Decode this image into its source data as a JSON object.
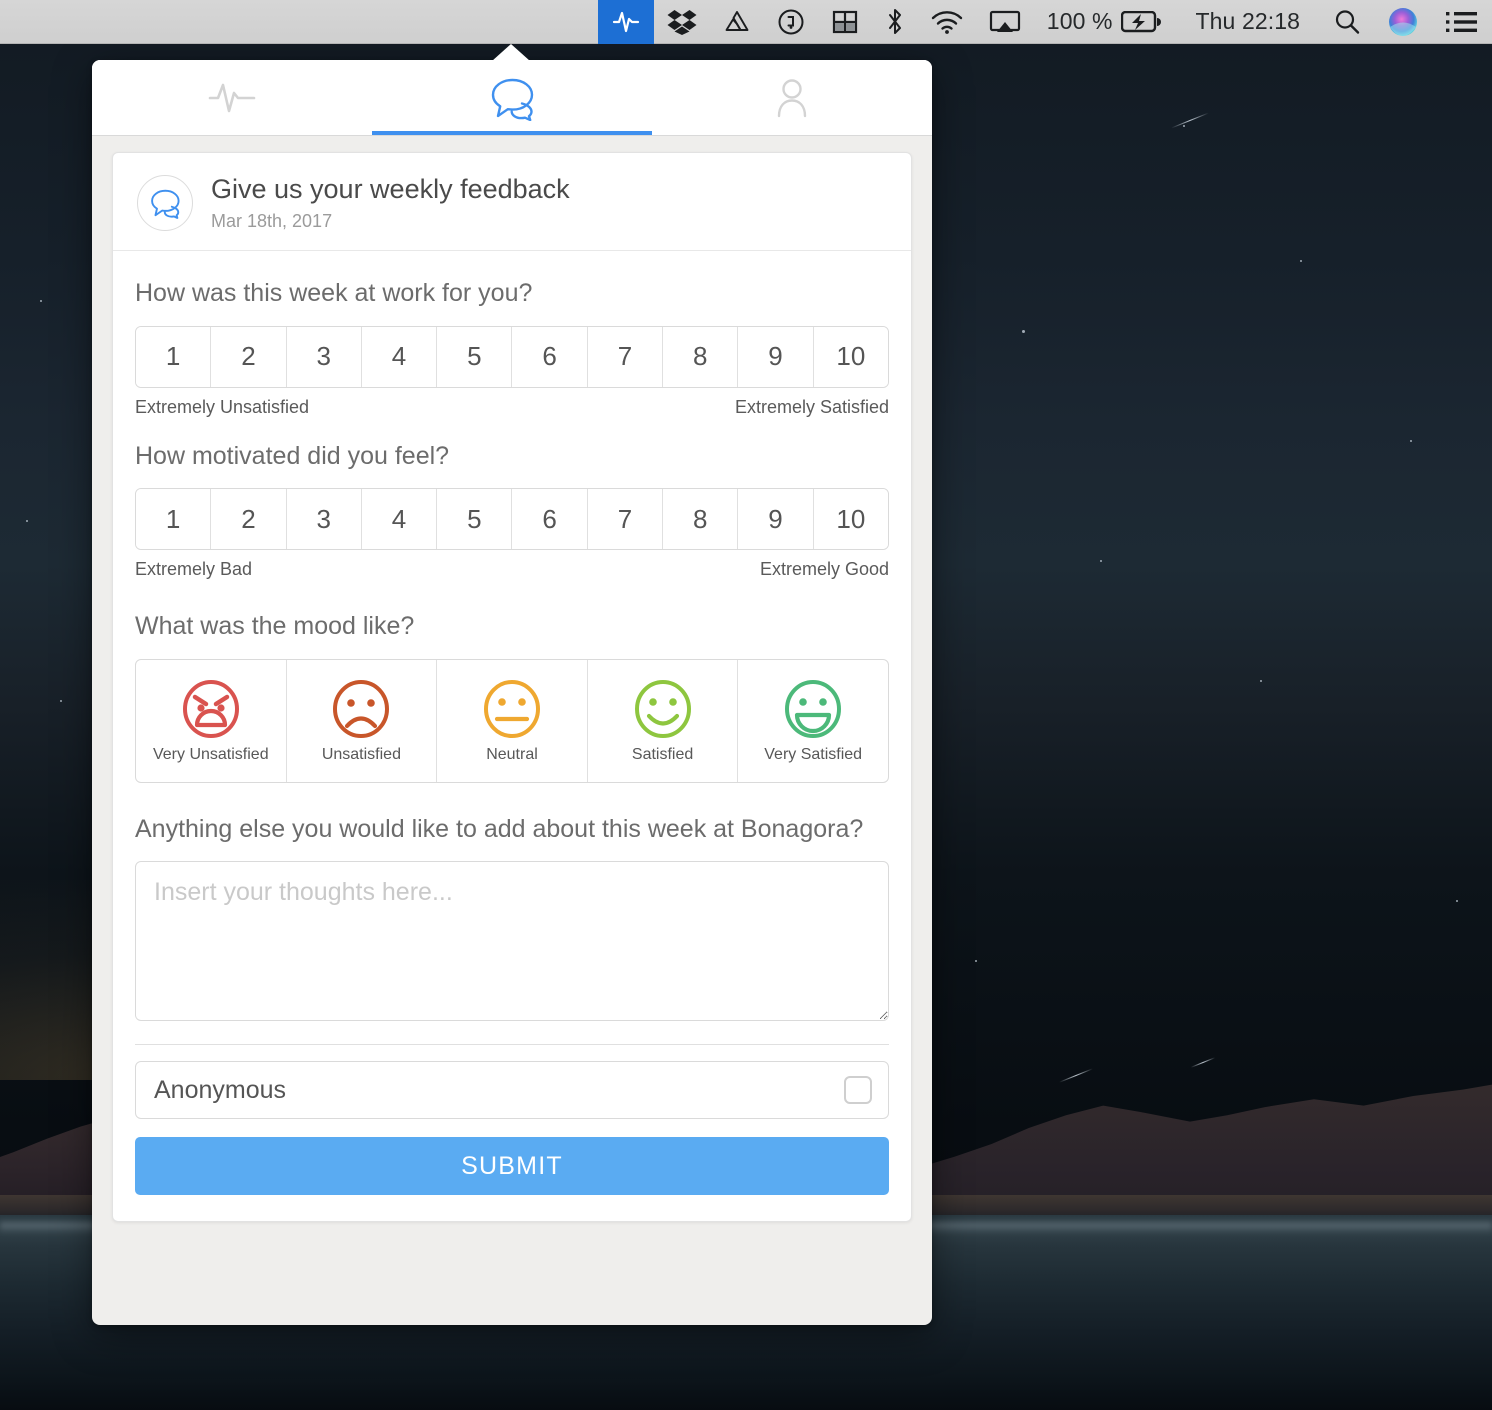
{
  "menubar": {
    "left_icons": [
      {
        "name": "activity-pulse-icon",
        "label": "Activity",
        "active": true
      },
      {
        "name": "dropbox-icon",
        "label": "Dropbox",
        "active": false
      },
      {
        "name": "google-drive-icon",
        "label": "Google Drive",
        "active": false
      },
      {
        "name": "circle-info-icon",
        "label": "Info",
        "active": false
      },
      {
        "name": "window-grid-icon",
        "label": "Window Grid",
        "active": false
      },
      {
        "name": "bluetooth-icon",
        "label": "Bluetooth",
        "active": false
      },
      {
        "name": "wifi-icon",
        "label": "Wi-Fi",
        "active": false
      },
      {
        "name": "airplay-icon",
        "label": "AirPlay",
        "active": false
      }
    ],
    "battery_percent": "100 %",
    "battery_icon": "battery-charging-icon",
    "clock": "Thu 22:18",
    "right_icons": [
      {
        "name": "search-icon",
        "label": "Spotlight Search"
      },
      {
        "name": "siri-icon",
        "label": "Siri"
      },
      {
        "name": "notification-center-icon",
        "label": "Notification Center"
      }
    ]
  },
  "popover": {
    "tabs": [
      {
        "id": "tab-activity",
        "icon": "activity-pulse-icon",
        "label": "Activity",
        "selected": false
      },
      {
        "id": "tab-feedback",
        "icon": "speech-bubbles-icon",
        "label": "Feedback",
        "selected": true
      },
      {
        "id": "tab-profile",
        "icon": "person-icon",
        "label": "Profile",
        "selected": false
      }
    ],
    "card": {
      "avatar_icon": "speech-bubbles-icon",
      "title": "Give us your weekly feedback",
      "date": "Mar 18th, 2017"
    },
    "questions": [
      {
        "id": "week-at-work",
        "text": "How was this week at work for you?",
        "type": "scale-10",
        "options": [
          "1",
          "2",
          "3",
          "4",
          "5",
          "6",
          "7",
          "8",
          "9",
          "10"
        ],
        "legend_low": "Extremely Unsatisfied",
        "legend_high": "Extremely Satisfied"
      },
      {
        "id": "motivation",
        "text": "How motivated did you feel?",
        "type": "scale-10",
        "options": [
          "1",
          "2",
          "3",
          "4",
          "5",
          "6",
          "7",
          "8",
          "9",
          "10"
        ],
        "legend_low": "Extremely Bad",
        "legend_high": "Extremely Good"
      },
      {
        "id": "mood",
        "text": "What was the mood like?",
        "type": "mood-faces",
        "moods": [
          {
            "label": "Very Unsatisfied",
            "icon": "angry-face-icon",
            "color": "#d9534f"
          },
          {
            "label": "Unsatisfied",
            "icon": "sad-face-icon",
            "color": "#c8562a"
          },
          {
            "label": "Neutral",
            "icon": "neutral-face-icon",
            "color": "#efa830"
          },
          {
            "label": "Satisfied",
            "icon": "smiling-face-icon",
            "color": "#8ec63f"
          },
          {
            "label": "Very Satisfied",
            "icon": "grinning-face-icon",
            "color": "#4cb97a"
          }
        ]
      }
    ],
    "freeform": {
      "question": "Anything else you would like to add about this week at Bonagora?",
      "placeholder": "Insert your thoughts here...",
      "value": ""
    },
    "anonymous": {
      "label": "Anonymous",
      "checked": false
    },
    "submit_label": "SUBMIT"
  },
  "colors": {
    "accent": "#3f90ef",
    "submit": "#5aabf2",
    "menubar_active": "#1d6fd4",
    "popover_bg": "#efeeec"
  }
}
